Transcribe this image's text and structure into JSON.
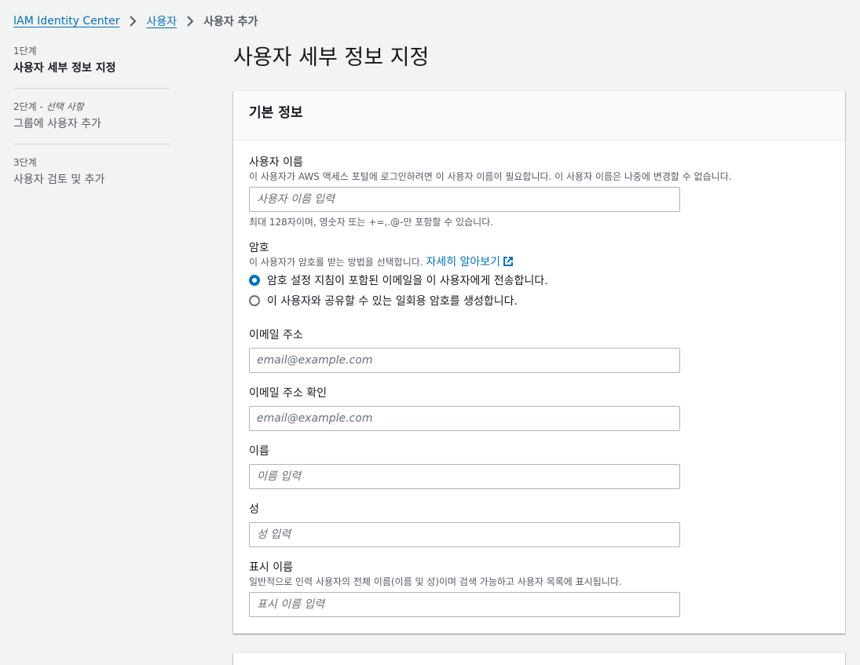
{
  "breadcrumb": {
    "items": [
      "IAM Identity Center",
      "사용자"
    ],
    "current": "사용자 추가"
  },
  "steps": [
    {
      "number": "1단계",
      "optional": "",
      "title": "사용자 세부 정보 지정"
    },
    {
      "number": "2단계",
      "optional": "선택 사항",
      "title": "그룹에 사용자 추가"
    },
    {
      "number": "3단계",
      "optional": "",
      "title": "사용자 검토 및 추가"
    }
  ],
  "page_title": "사용자 세부 정보 지정",
  "section": {
    "title": "기본 정보",
    "username": {
      "label": "사용자 이름",
      "description": "이 사용자가 AWS 액세스 포털에 로그인하려면 이 사용자 이름이 필요합니다. 이 사용자 이름은 나중에 변경할 수 없습니다.",
      "placeholder": "사용자 이름 입력",
      "value": "",
      "constraint": "최대 128자이며, 영숫자 또는 +=,.@-만 포함할 수 있습니다."
    },
    "password": {
      "label": "암호",
      "description": "이 사용자가 암호를 받는 방법을 선택합니다.",
      "learn_more": "자세히 알아보기",
      "options": [
        {
          "label": "암호 설정 지침이 포함된 이메일을 이 사용자에게 전송합니다.",
          "checked": true
        },
        {
          "label": "이 사용자와 공유할 수 있는 일회용 암호를 생성합니다.",
          "checked": false
        }
      ]
    },
    "email": {
      "label": "이메일 주소",
      "placeholder": "email@example.com",
      "value": ""
    },
    "email_confirm": {
      "label": "이메일 주소 확인",
      "placeholder": "email@example.com",
      "value": ""
    },
    "first_name": {
      "label": "이름",
      "placeholder": "이름 입력",
      "value": ""
    },
    "last_name": {
      "label": "성",
      "placeholder": "성 입력",
      "value": ""
    },
    "display_name": {
      "label": "표시 이름",
      "description": "일반적으로 인력 사용자의 전체 이름(이름 및 성)이며 검색 가능하고 사용자 목록에 표시됩니다.",
      "placeholder": "표시 이름 입력",
      "value": ""
    }
  },
  "colors": {
    "link": "#0073bb",
    "background": "#f2f3f3",
    "text": "#16191f",
    "secondary_text": "#545b64"
  },
  "icons": {
    "breadcrumb_separator": "chevron-right-icon",
    "external_link": "external-link-icon"
  }
}
